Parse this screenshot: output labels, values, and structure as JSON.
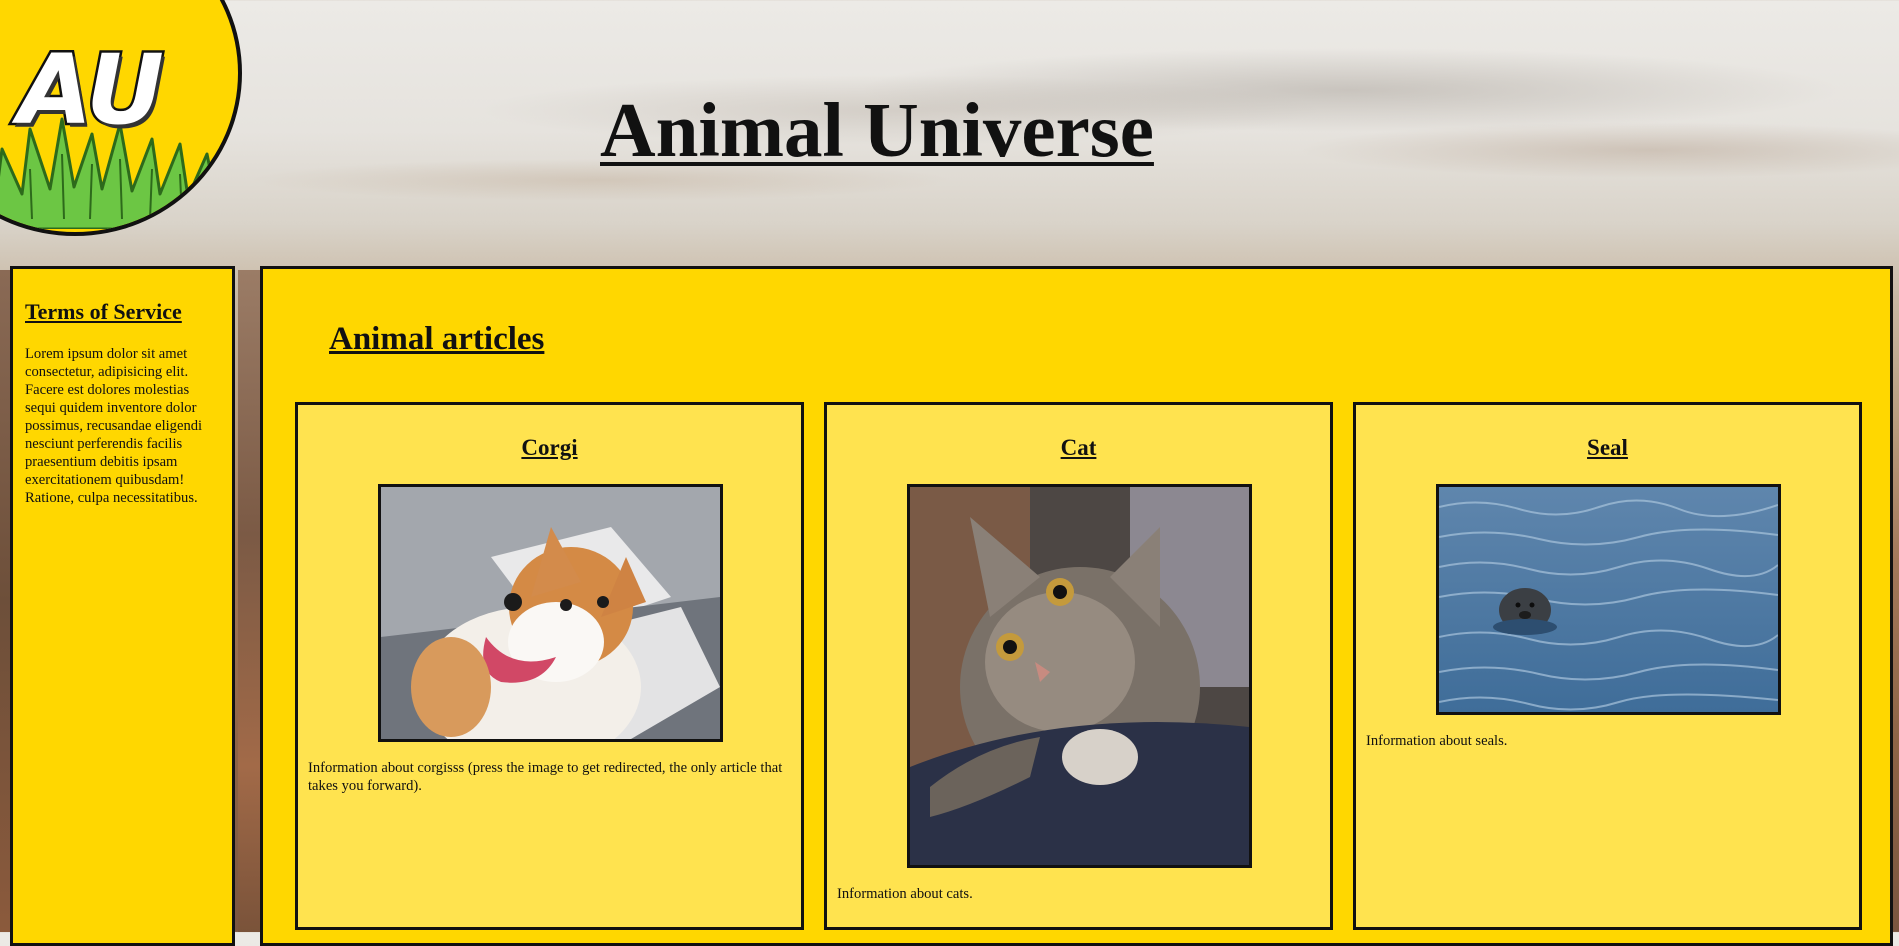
{
  "logo": {
    "text": "AU"
  },
  "header": {
    "title": "Animal Universe"
  },
  "sidebar": {
    "heading": "Terms of Service",
    "body": "Lorem ipsum dolor sit amet consectetur, adipisicing elit. Facere est dolores molestias sequi quidem inventore dolor possimus, recusandae eligendi nesciunt perferendis facilis praesentium debitis ipsam exercitationem quibusdam! Ratione, culpa necessitatibus."
  },
  "main": {
    "heading": "Animal articles",
    "cards": [
      {
        "title": "Corgi",
        "image": "corgi-photo",
        "text": "Information about corgisss (press the image to get redirected, the only article that takes you forward)."
      },
      {
        "title": "Cat",
        "image": "cat-photo",
        "text": "Information about cats."
      },
      {
        "title": "Seal",
        "image": "seal-photo",
        "text": "Information about seals."
      }
    ]
  },
  "colors": {
    "panel": "#ffd700",
    "card": "#ffe34f",
    "border": "#111111"
  }
}
